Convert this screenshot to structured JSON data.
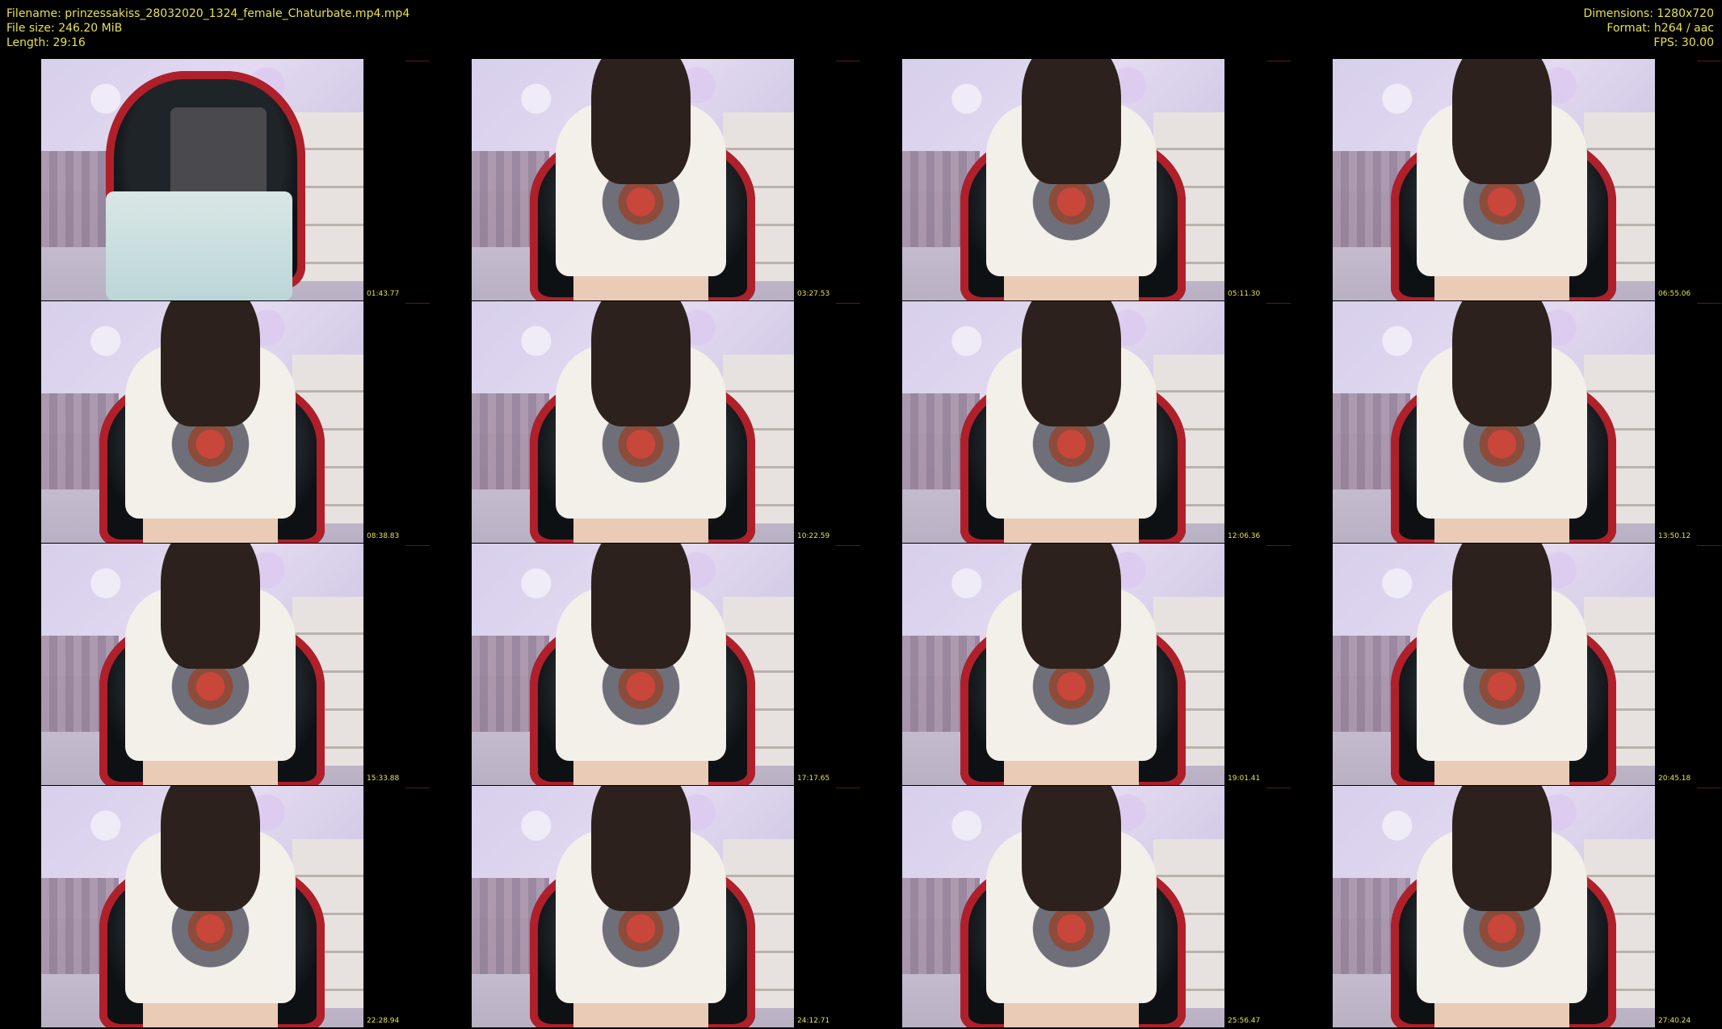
{
  "header": {
    "filename_label": "Filename: prinzessakiss_28032020_1324_female_Chaturbate.mp4.mp4",
    "filesize_label": "File size: 246.20 MiB",
    "length_label": "Length: 29:16",
    "dimensions_label": "Dimensions: 1280x720",
    "format_label": "Format: h264 / aac",
    "fps_label": "FPS: 30.00"
  },
  "thumbnails": [
    {
      "timestamp": "01:43.77",
      "scene": "empty-chair"
    },
    {
      "timestamp": "03:27.53",
      "scene": "person"
    },
    {
      "timestamp": "05:11.30",
      "scene": "person"
    },
    {
      "timestamp": "06:55.06",
      "scene": "person"
    },
    {
      "timestamp": "08:38.83",
      "scene": "person"
    },
    {
      "timestamp": "10:22.59",
      "scene": "person"
    },
    {
      "timestamp": "12:06.36",
      "scene": "person"
    },
    {
      "timestamp": "13:50.12",
      "scene": "person"
    },
    {
      "timestamp": "15:33.88",
      "scene": "person"
    },
    {
      "timestamp": "17:17.65",
      "scene": "person"
    },
    {
      "timestamp": "19:01.41",
      "scene": "person"
    },
    {
      "timestamp": "20:45.18",
      "scene": "person"
    },
    {
      "timestamp": "22:28.94",
      "scene": "person"
    },
    {
      "timestamp": "24:12.71",
      "scene": "person"
    },
    {
      "timestamp": "25:56.47",
      "scene": "person"
    },
    {
      "timestamp": "27:40.24",
      "scene": "person"
    }
  ],
  "colors": {
    "background": "#000000",
    "text": "#e8e24a"
  }
}
